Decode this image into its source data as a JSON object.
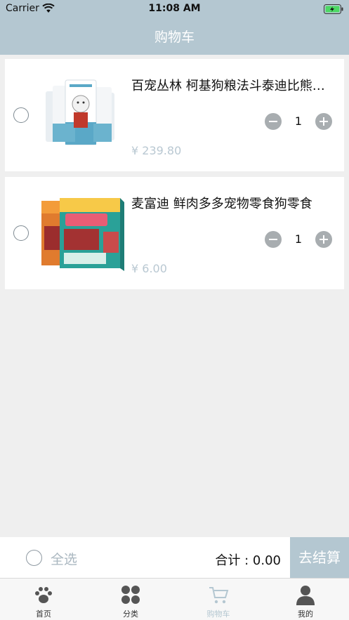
{
  "status_bar": {
    "carrier": "Carrier",
    "time": "11:08 AM"
  },
  "nav": {
    "title": "购物车"
  },
  "cart": {
    "items": [
      {
        "name": "百宠丛林 柯基狗粮法斗泰迪比熊博美雪纳瑞小型犬幼犬成犬通用狗粮",
        "quantity": "1",
        "price": "¥ 239.80",
        "image": "dog-food-bags-image"
      },
      {
        "name": "麦富迪 鲜肉多多宠物零食狗零食",
        "quantity": "1",
        "price": "¥ 6.00",
        "image": "fresh-meat-box-image"
      }
    ]
  },
  "footer": {
    "select_all": "全选",
    "total": "合计 : 0.00",
    "checkout": "去结算"
  },
  "tabs": [
    {
      "label": "首页",
      "icon": "paw-icon"
    },
    {
      "label": "分类",
      "icon": "category-grid-icon"
    },
    {
      "label": "购物车",
      "icon": "cart-icon",
      "active": true
    },
    {
      "label": "我的",
      "icon": "user-icon"
    }
  ],
  "colors": {
    "accent": "#b4c7d1",
    "price": "#b9c8d2",
    "background": "#efefef"
  }
}
